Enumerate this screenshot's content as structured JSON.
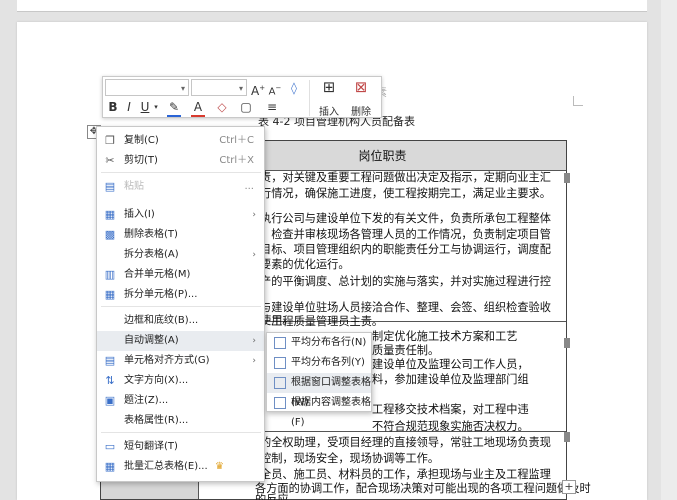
{
  "document": {
    "behind_text": "素",
    "caption": "表 4-2 项目管理机构人员配备表",
    "table": {
      "header": "岗位职责",
      "lines": [
        "责，对关键及重要工程问题做出决定及指示，定期向业主汇",
        "行情况，确保施工进度，使工程按期完工，满足业主要求。",
        "执行公司与建设单位下发的有关文件，负责所承包工程整体",
        "，检查并审核现场各管理人员的工作情况，负责制定项目管",
        "目标、项目管理组织内的职能责任分工与协调运行，调度配",
        "要素的优化运行。",
        "产的平衡调度、总计划的实施与落实，并对实施过程进行控",
        "",
        "与建设单位驻场人员接洽合作、整理、会签、组织检查验收",
        "使用。",
        "、工程质量管理员主责。",
        "制定优化施工技术方案和工艺",
        "质量责任制。",
        "建设单位及监理公司工作人员，",
        "料，参加建设单位及监理部门组",
        "",
        "工程移交技术档案，对工程中违",
        "不符合规范现象实施否决权力。",
        "的全权助理，受项目经理的直接领导，常驻工地现场负责现",
        "控制，现场安全，现场协调等工作。",
        "全员、施工员、材料员的工作，承担现场与业主及工程监理",
        "各方面的协调工作，配合现场决策对可能出现的各项工程问题做及时",
        "的反应。"
      ]
    },
    "plus_symbol": "+",
    "move_symbol": "✥"
  },
  "toolbar": {
    "font_name": "",
    "font_size": "",
    "grow_font": "A",
    "shrink_font": "A",
    "format_painter_icon": "eraser-icon",
    "bold": "B",
    "italic": "I",
    "underline": "U",
    "highlight": "A",
    "font_color": "A",
    "insert_label": "插入",
    "delete_label": "删除",
    "colors": {
      "highlight": "#2a64d6",
      "font_color": "#d83a2e"
    }
  },
  "context_menu": {
    "items": [
      {
        "label": "复制(C)",
        "shortcut": "Ctrl＋C",
        "icon": "copy-icon"
      },
      {
        "label": "剪切(T)",
        "shortcut": "Ctrl＋X",
        "icon": "scissors-icon"
      },
      {
        "label": "粘贴",
        "shortcut": "...",
        "icon": "paste-icon",
        "disabled": true
      },
      {
        "label": "插入(I)",
        "icon": "insert-table-icon",
        "submenu": true
      },
      {
        "label": "删除表格(T)",
        "icon": "delete-table-icon"
      },
      {
        "label": "拆分表格(A)",
        "submenu": true
      },
      {
        "label": "合并单元格(M)",
        "icon": "merge-cells-icon"
      },
      {
        "label": "拆分单元格(P)...",
        "icon": "split-cells-icon"
      },
      {
        "label": "边框和底纹(B)..."
      },
      {
        "label": "自动调整(A)",
        "submenu": true,
        "highlighted": true
      },
      {
        "label": "单元格对齐方式(G)",
        "icon": "cell-align-icon",
        "submenu": true
      },
      {
        "label": "文字方向(X)...",
        "icon": "text-direction-icon"
      },
      {
        "label": "题注(Z)...",
        "icon": "caption-icon"
      },
      {
        "label": "表格属性(R)..."
      },
      {
        "label": "短句翻译(T)",
        "icon": "translate-icon"
      },
      {
        "label": "批量汇总表格(E)...",
        "icon": "batch-summary-icon",
        "badge": "crown-icon"
      }
    ]
  },
  "submenu": {
    "items": [
      {
        "label": "平均分布各行(N)",
        "icon": "distribute-rows-icon"
      },
      {
        "label": "平均分布各列(Y)",
        "icon": "distribute-columns-icon"
      },
      {
        "label": "根据窗口调整表格(W)",
        "icon": "fit-window-icon",
        "highlighted": true
      },
      {
        "label": "根据内容调整表格(F)",
        "icon": "fit-content-icon"
      }
    ]
  }
}
